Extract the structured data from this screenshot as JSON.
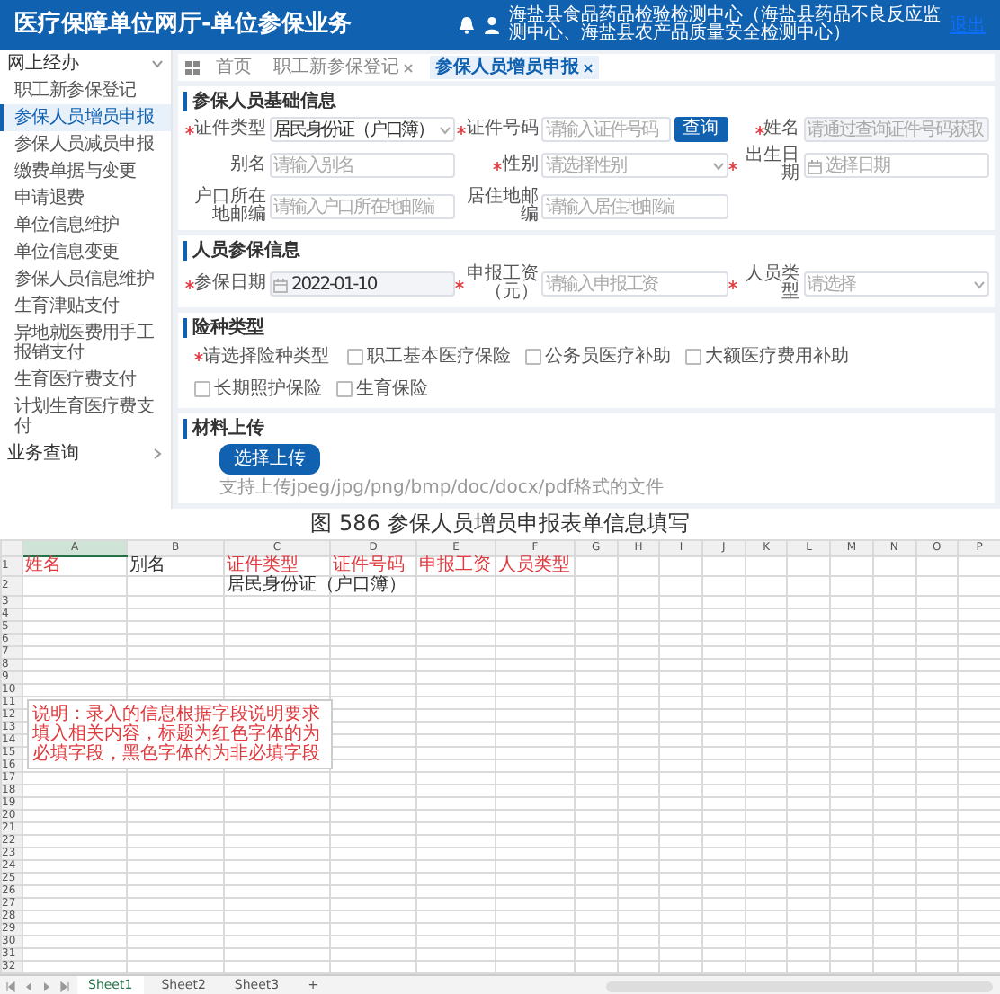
{
  "header": {
    "title": "医疗保障单位网厅-单位参保业务",
    "user": "海盐县食品药品检验检测中心（海盐县药品不良反应监测中心、海盐县农产品质量安全检测中心）",
    "logout": "退出"
  },
  "sidebar": {
    "groups": [
      {
        "label": "网上经办",
        "expanded": true,
        "items": [
          {
            "label": "职工新参保登记",
            "selected": false
          },
          {
            "label": "参保人员增员申报",
            "selected": true
          },
          {
            "label": "参保人员减员申报",
            "selected": false
          },
          {
            "label": "缴费单据与变更",
            "selected": false
          },
          {
            "label": "申请退费",
            "selected": false
          },
          {
            "label": "单位信息维护",
            "selected": false
          },
          {
            "label": "单位信息变更",
            "selected": false
          },
          {
            "label": "参保人员信息维护",
            "selected": false
          },
          {
            "label": "生育津贴支付",
            "selected": false
          },
          {
            "label": "异地就医费用手工报销支付",
            "selected": false
          },
          {
            "label": "生育医疗费支付",
            "selected": false
          },
          {
            "label": "计划生育医疗费支付",
            "selected": false
          }
        ]
      },
      {
        "label": "业务查询",
        "expanded": false
      }
    ]
  },
  "tabs": [
    {
      "label": "首页",
      "kind": "home",
      "selected": false
    },
    {
      "label": "职工新参保登记",
      "kind": "page",
      "selected": false
    },
    {
      "label": "参保人员增员申报",
      "kind": "page",
      "selected": true
    }
  ],
  "sections": [
    {
      "title": "参保人员基础信息",
      "kind": "form",
      "fields": [
        {
          "label": "证件类型",
          "required": true,
          "kind": "select",
          "value": "居民身份证（户口簿）",
          "disabled": false
        },
        {
          "label": "证件号码",
          "required": true,
          "kind": "search",
          "placeholder": "请输入证件号码",
          "button": "查询",
          "disabled": false
        },
        {
          "label": "姓名",
          "required": true,
          "kind": "input",
          "placeholder": "请通过查询证件号码获取",
          "disabled": true
        },
        {
          "label": "别名",
          "required": false,
          "kind": "input",
          "placeholder": "请输入别名",
          "disabled": false
        },
        {
          "label": "性别",
          "required": true,
          "kind": "select",
          "placeholder": "请选择性别",
          "disabled": false
        },
        {
          "label": "出生日期",
          "required": true,
          "kind": "date",
          "placeholder": "选择日期",
          "disabled": false
        },
        {
          "label": "户口所在地邮编",
          "required": false,
          "kind": "input",
          "placeholder": "请输入户口所在地邮编",
          "disabled": false
        },
        {
          "label": "居住地邮编",
          "required": false,
          "kind": "input",
          "placeholder": "请输入居住地邮编",
          "disabled": false
        }
      ]
    },
    {
      "title": "人员参保信息",
      "kind": "form",
      "fields": [
        {
          "label": "参保日期",
          "required": true,
          "kind": "date",
          "value": "2022-01-10",
          "disabled": true
        },
        {
          "label": "申报工资（元）",
          "required": true,
          "kind": "input",
          "placeholder": "请输入申报工资",
          "disabled": false
        },
        {
          "label": "人员类型",
          "required": true,
          "kind": "select",
          "placeholder": "请选择",
          "disabled": false
        }
      ]
    },
    {
      "title": "险种类型",
      "kind": "checks",
      "label": "请选择险种类型",
      "required": true,
      "options": [
        {
          "label": "职工基本医疗保险",
          "checked": false
        },
        {
          "label": "公务员医疗补助",
          "checked": false
        },
        {
          "label": "大额医疗费用补助",
          "checked": false
        },
        {
          "label": "长期照护保险",
          "checked": false
        },
        {
          "label": "生育保险",
          "checked": false
        }
      ]
    },
    {
      "title": "材料上传",
      "kind": "upload",
      "button": "选择上传",
      "hint": "支持上传jpeg/jpg/png/bmp/doc/docx/pdf格式的文件"
    }
  ],
  "caption": "图 586 参保人员增员申报表单信息填写",
  "spreadsheet": {
    "columns": [
      {
        "label": "A",
        "selected": true
      },
      {
        "label": "B",
        "selected": false
      },
      {
        "label": "C",
        "selected": false
      },
      {
        "label": "D",
        "selected": false
      },
      {
        "label": "E",
        "selected": false
      },
      {
        "label": "F",
        "selected": false
      },
      {
        "label": "G",
        "selected": false
      },
      {
        "label": "H",
        "selected": false
      },
      {
        "label": "I",
        "selected": false
      },
      {
        "label": "J",
        "selected": false
      },
      {
        "label": "K",
        "selected": false
      },
      {
        "label": "L",
        "selected": false
      },
      {
        "label": "M",
        "selected": false
      },
      {
        "label": "N",
        "selected": false
      },
      {
        "label": "O",
        "selected": false
      },
      {
        "label": "P",
        "selected": false
      }
    ],
    "rows": [
      {
        "number": "1",
        "cells": [
          {
            "kind": "text",
            "text": "姓名",
            "required": true
          },
          {
            "kind": "text",
            "text": "别名",
            "required": false
          },
          {
            "kind": "text",
            "text": "证件类型",
            "required": true
          },
          {
            "kind": "text",
            "text": "证件号码",
            "required": true
          },
          {
            "kind": "text",
            "text": "申报工资",
            "required": true
          },
          {
            "kind": "text",
            "text": "人员类型",
            "required": true
          }
        ]
      },
      {
        "number": "2",
        "cells": [
          {
            "kind": "empty"
          },
          {
            "kind": "empty"
          },
          {
            "kind": "text",
            "text": "居民身份证（户口簿）",
            "required": false
          }
        ]
      },
      {
        "number": "3"
      },
      {
        "number": "4"
      },
      {
        "number": "5"
      },
      {
        "number": "6"
      },
      {
        "number": "7"
      },
      {
        "number": "8"
      },
      {
        "number": "9"
      },
      {
        "number": "10"
      },
      {
        "number": "11",
        "note": "说明：录入的信息根据字段说明要求填入相关内容，标题为红色字体的为必填字段，黑色字体的为非必填字段"
      },
      {
        "number": "12"
      },
      {
        "number": "13"
      },
      {
        "number": "14"
      },
      {
        "number": "15"
      },
      {
        "number": "16"
      },
      {
        "number": "17"
      },
      {
        "number": "18"
      },
      {
        "number": "19"
      },
      {
        "number": "20"
      },
      {
        "number": "21"
      },
      {
        "number": "22"
      },
      {
        "number": "23"
      },
      {
        "number": "24"
      },
      {
        "number": "25"
      },
      {
        "number": "26"
      },
      {
        "number": "27"
      },
      {
        "number": "28"
      },
      {
        "number": "29"
      },
      {
        "number": "30"
      },
      {
        "number": "31"
      },
      {
        "number": "32"
      }
    ],
    "sheet_tabs": [
      {
        "label": "Sheet1",
        "selected": true
      },
      {
        "label": "Sheet2",
        "selected": false
      },
      {
        "label": "Sheet3",
        "selected": false
      }
    ],
    "add_tab": "+"
  }
}
